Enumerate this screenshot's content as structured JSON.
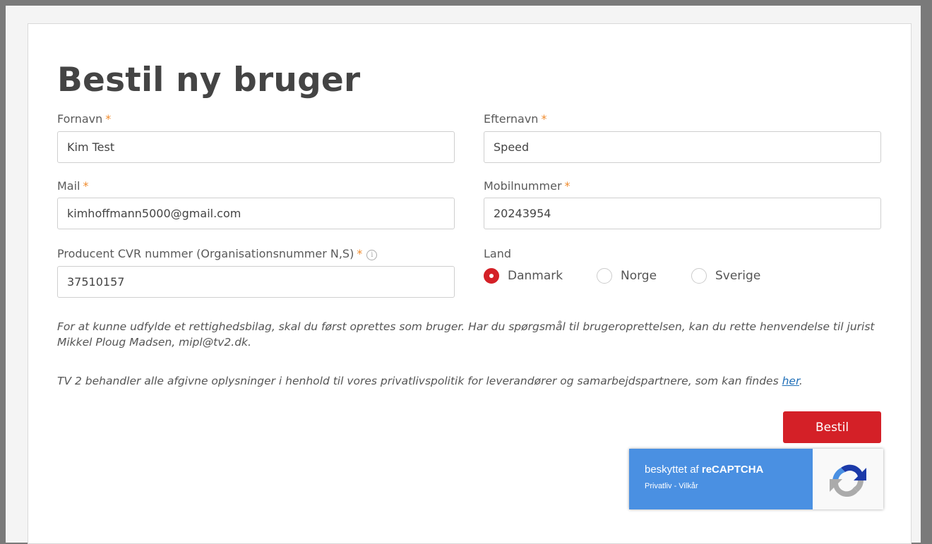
{
  "form": {
    "title": "Bestil ny bruger",
    "fields": {
      "fornavn": {
        "label": "Fornavn",
        "required_mark": "*",
        "value": "Kim Test"
      },
      "efternavn": {
        "label": "Efternavn",
        "required_mark": "*",
        "value": "Speed"
      },
      "mail": {
        "label": "Mail",
        "required_mark": "*",
        "value": "kimhoffmann5000@gmail.com"
      },
      "mobil": {
        "label": "Mobilnummer",
        "required_mark": "*",
        "value": "20243954"
      },
      "cvr": {
        "label": "Producent CVR nummer (Organisationsnummer N,S)",
        "required_mark": "*",
        "info_glyph": "i",
        "value": "37510157"
      }
    },
    "land": {
      "label": "Land",
      "options": [
        {
          "label": "Danmark",
          "selected": true
        },
        {
          "label": "Norge",
          "selected": false
        },
        {
          "label": "Sverige",
          "selected": false
        }
      ]
    },
    "note1": "For at kunne udfylde et rettighedsbilag, skal du først oprettes som bruger. Har du spørgsmål til brugeroprettelsen, kan du rette henvendelse til jurist Mikkel Ploug Madsen, mipl@tv2.dk.",
    "note2_text": "TV 2 behandler alle afgivne oplysninger i henhold til vores privatlivspolitik for leverandører og samarbejdspartnere, som kan findes ",
    "note2_link": "her",
    "note2_end": ".",
    "submit_label": "Bestil"
  },
  "recaptcha": {
    "prefix": "beskyttet af ",
    "brand": "reCAPTCHA",
    "privacy": "Privatliv",
    "separator": " - ",
    "terms": "Vilkår"
  },
  "colors": {
    "accent": "#d42027",
    "required": "#f08c2e",
    "link": "#1f6fb8",
    "recaptcha_blue": "#4a90e2"
  }
}
